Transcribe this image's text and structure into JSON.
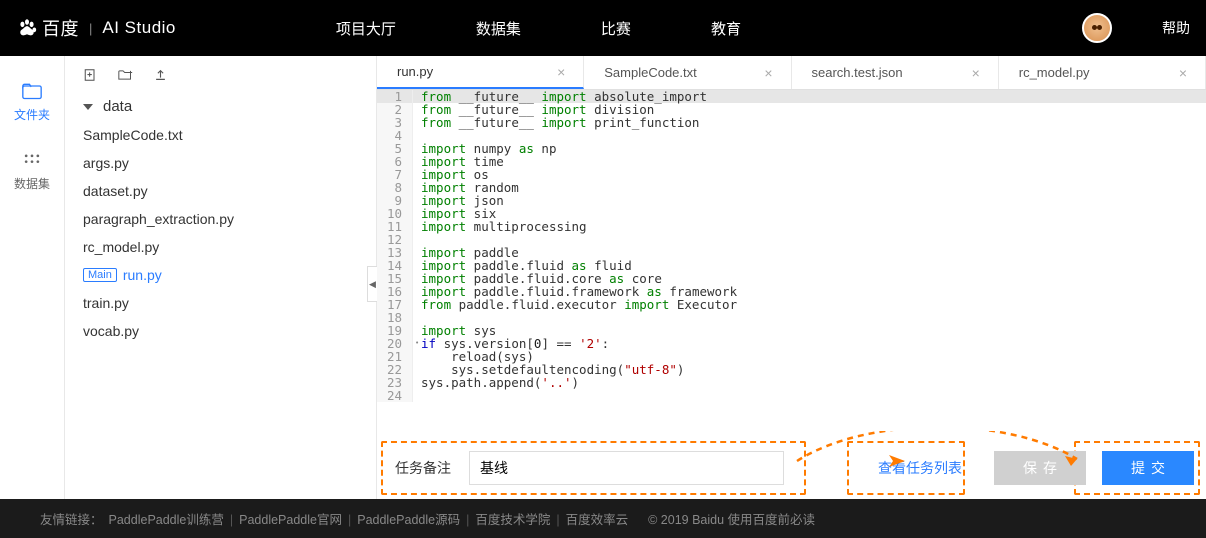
{
  "header": {
    "brand_main": "百度",
    "brand_sub": "AI Studio",
    "nav": [
      "项目大厅",
      "数据集",
      "比赛",
      "教育"
    ],
    "help": "帮助"
  },
  "left_rail": {
    "files": "文件夹",
    "dataset": "数据集"
  },
  "file_tree": {
    "folder": "data",
    "files": [
      {
        "name": "SampleCode.txt",
        "main": false,
        "active": false
      },
      {
        "name": "args.py",
        "main": false,
        "active": false
      },
      {
        "name": "dataset.py",
        "main": false,
        "active": false
      },
      {
        "name": "paragraph_extraction.py",
        "main": false,
        "active": false
      },
      {
        "name": "rc_model.py",
        "main": false,
        "active": false
      },
      {
        "name": "run.py",
        "main": true,
        "active": true
      },
      {
        "name": "train.py",
        "main": false,
        "active": false
      },
      {
        "name": "vocab.py",
        "main": false,
        "active": false
      }
    ],
    "main_badge": "Main"
  },
  "tabs": [
    {
      "label": "run.py",
      "active": true
    },
    {
      "label": "SampleCode.txt",
      "active": false
    },
    {
      "label": "search.test.json",
      "active": false
    },
    {
      "label": "rc_model.py",
      "active": false
    }
  ],
  "code_lines": [
    {
      "n": 1,
      "tokens": [
        [
          "kw",
          "from"
        ],
        [
          "",
          " __future__ "
        ],
        [
          "kw",
          "import"
        ],
        [
          "",
          " absolute_import"
        ]
      ]
    },
    {
      "n": 2,
      "tokens": [
        [
          "kw",
          "from"
        ],
        [
          "",
          " __future__ "
        ],
        [
          "kw",
          "import"
        ],
        [
          "",
          " division"
        ]
      ]
    },
    {
      "n": 3,
      "tokens": [
        [
          "kw",
          "from"
        ],
        [
          "",
          " __future__ "
        ],
        [
          "kw",
          "import"
        ],
        [
          "",
          " print_function"
        ]
      ]
    },
    {
      "n": 4,
      "tokens": []
    },
    {
      "n": 5,
      "tokens": [
        [
          "kw",
          "import"
        ],
        [
          "",
          " numpy "
        ],
        [
          "kw",
          "as"
        ],
        [
          "",
          " np"
        ]
      ]
    },
    {
      "n": 6,
      "tokens": [
        [
          "kw",
          "import"
        ],
        [
          "",
          " time"
        ]
      ]
    },
    {
      "n": 7,
      "tokens": [
        [
          "kw",
          "import"
        ],
        [
          "",
          " os"
        ]
      ]
    },
    {
      "n": 8,
      "tokens": [
        [
          "kw",
          "import"
        ],
        [
          "",
          " random"
        ]
      ]
    },
    {
      "n": 9,
      "tokens": [
        [
          "kw",
          "import"
        ],
        [
          "",
          " json"
        ]
      ]
    },
    {
      "n": 10,
      "tokens": [
        [
          "kw",
          "import"
        ],
        [
          "",
          " six"
        ]
      ]
    },
    {
      "n": 11,
      "tokens": [
        [
          "kw",
          "import"
        ],
        [
          "",
          " multiprocessing"
        ]
      ]
    },
    {
      "n": 12,
      "tokens": []
    },
    {
      "n": 13,
      "tokens": [
        [
          "kw",
          "import"
        ],
        [
          "",
          " paddle"
        ]
      ]
    },
    {
      "n": 14,
      "tokens": [
        [
          "kw",
          "import"
        ],
        [
          "",
          " paddle.fluid "
        ],
        [
          "kw",
          "as"
        ],
        [
          "",
          " fluid"
        ]
      ]
    },
    {
      "n": 15,
      "tokens": [
        [
          "kw",
          "import"
        ],
        [
          "",
          " paddle.fluid.core "
        ],
        [
          "kw",
          "as"
        ],
        [
          "",
          " core"
        ]
      ]
    },
    {
      "n": 16,
      "tokens": [
        [
          "kw",
          "import"
        ],
        [
          "",
          " paddle.fluid.framework "
        ],
        [
          "kw",
          "as"
        ],
        [
          "",
          " framework"
        ]
      ]
    },
    {
      "n": 17,
      "tokens": [
        [
          "kw",
          "from"
        ],
        [
          "",
          " paddle.fluid.executor "
        ],
        [
          "kw",
          "import"
        ],
        [
          "",
          " Executor"
        ]
      ]
    },
    {
      "n": 18,
      "tokens": []
    },
    {
      "n": 19,
      "tokens": [
        [
          "kw",
          "import"
        ],
        [
          "",
          " sys"
        ]
      ]
    },
    {
      "n": 20,
      "dot": true,
      "tokens": [
        [
          "kw2",
          "if"
        ],
        [
          "",
          " sys.version["
        ],
        [
          "num",
          "0"
        ],
        [
          "",
          "] == "
        ],
        [
          "str",
          "'2'"
        ],
        [
          "",
          ":"
        ]
      ]
    },
    {
      "n": 21,
      "tokens": [
        [
          "",
          "    reload(sys)"
        ]
      ]
    },
    {
      "n": 22,
      "tokens": [
        [
          "",
          "    sys.setdefaultencoding("
        ],
        [
          "str",
          "\"utf-8\""
        ],
        [
          "",
          ")"
        ]
      ]
    },
    {
      "n": 23,
      "tokens": [
        [
          "",
          "sys.path.append("
        ],
        [
          "str",
          "'..'"
        ],
        [
          "",
          ")"
        ]
      ]
    },
    {
      "n": 24,
      "tokens": []
    }
  ],
  "action_bar": {
    "task_label": "任务备注",
    "task_value": "基线",
    "view_tasks": "查看任务列表",
    "save": "保存",
    "submit": "提交"
  },
  "footer": {
    "label": "友情链接：",
    "links": [
      "PaddlePaddle训练营",
      "PaddlePaddle官网",
      "PaddlePaddle源码",
      "百度技术学院",
      "百度效率云"
    ],
    "copyright": "© 2019 Baidu 使用百度前必读"
  }
}
